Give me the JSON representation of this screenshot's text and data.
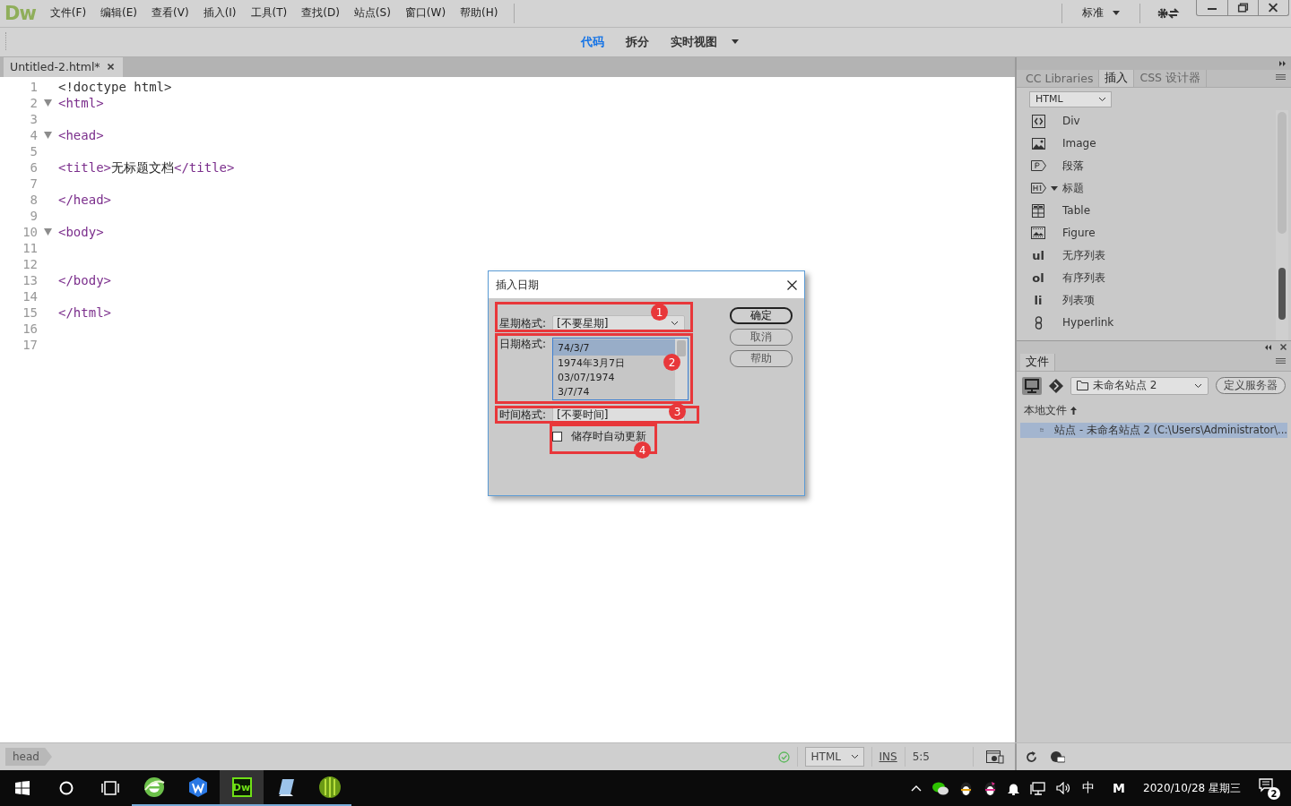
{
  "app": {
    "logo": "Dw",
    "menu": [
      "文件(F)",
      "编辑(E)",
      "查看(V)",
      "插入(I)",
      "工具(T)",
      "查找(D)",
      "站点(S)",
      "窗口(W)",
      "帮助(H)"
    ],
    "workspace": "标准"
  },
  "view_tabs": [
    {
      "label": "代码",
      "selected": true
    },
    {
      "label": "拆分",
      "selected": false
    },
    {
      "label": "实时视图",
      "selected": false
    }
  ],
  "document_tab": {
    "title": "Untitled-2.html*"
  },
  "code_lines": [
    {
      "number": "1",
      "foldable": false,
      "segments": [
        {
          "kind": "doctype",
          "text": "<!doctype html>"
        }
      ]
    },
    {
      "number": "2",
      "foldable": true,
      "segments": [
        {
          "kind": "tag",
          "text": "<html>"
        }
      ]
    },
    {
      "number": "3",
      "foldable": false
    },
    {
      "number": "4",
      "foldable": true,
      "segments": [
        {
          "kind": "tag",
          "text": "<head>"
        }
      ]
    },
    {
      "number": "5",
      "foldable": false
    },
    {
      "number": "6",
      "foldable": false,
      "segments": [
        {
          "kind": "tag",
          "text": "<title>"
        },
        {
          "kind": "text",
          "text": "无标题文档"
        },
        {
          "kind": "tag",
          "text": "</title>"
        }
      ]
    },
    {
      "number": "7",
      "foldable": false
    },
    {
      "number": "8",
      "foldable": false,
      "segments": [
        {
          "kind": "tag",
          "text": "</head>"
        }
      ]
    },
    {
      "number": "9",
      "foldable": false
    },
    {
      "number": "10",
      "foldable": true,
      "segments": [
        {
          "kind": "tag",
          "text": "<body>"
        }
      ]
    },
    {
      "number": "11",
      "foldable": false
    },
    {
      "number": "12",
      "foldable": false
    },
    {
      "number": "13",
      "foldable": false,
      "segments": [
        {
          "kind": "tag",
          "text": "</body>"
        }
      ]
    },
    {
      "number": "14",
      "foldable": false
    },
    {
      "number": "15",
      "foldable": false,
      "segments": [
        {
          "kind": "tag",
          "text": "</html>"
        }
      ]
    },
    {
      "number": "16",
      "foldable": false
    },
    {
      "number": "17",
      "foldable": false
    }
  ],
  "insert_panel": {
    "tabs": [
      {
        "label": "CC Libraries",
        "selected": false
      },
      {
        "label": "插入",
        "selected": true
      },
      {
        "label": "CSS 设计器",
        "selected": false
      }
    ],
    "category": "HTML",
    "items": [
      {
        "kind": "div",
        "label": "Div",
        "expandable": false
      },
      {
        "kind": "image",
        "label": "Image",
        "expandable": false
      },
      {
        "kind": "paragraph",
        "label": "段落",
        "expandable": false
      },
      {
        "kind": "heading",
        "label": "标题",
        "expandable": true
      },
      {
        "kind": "table",
        "label": "Table",
        "expandable": false
      },
      {
        "kind": "figure",
        "label": "Figure",
        "expandable": false
      },
      {
        "kind": "glyph",
        "glyph": "ul",
        "label": "无序列表",
        "expandable": false
      },
      {
        "kind": "glyph",
        "glyph": "ol",
        "label": "有序列表",
        "expandable": false
      },
      {
        "kind": "glyph",
        "glyph": "li",
        "label": "列表项",
        "expandable": false
      },
      {
        "kind": "hyperlink",
        "label": "Hyperlink",
        "expandable": false
      }
    ]
  },
  "files_panel": {
    "tab": "文件",
    "site": "未命名站点 2",
    "define_server": "定义服务器",
    "header": "本地文件",
    "rows": [
      {
        "label": "站点 - 未命名站点 2 (C:\\Users\\Administrator\\...",
        "selected": true
      }
    ]
  },
  "status_bar": {
    "tag": "head",
    "language": "HTML",
    "mode": "INS",
    "position": "5:5"
  },
  "dialog": {
    "title": "插入日期",
    "weekday_label": "星期格式:",
    "weekday_value": "[不要星期]",
    "date_label": "日期格式:",
    "date_options": [
      {
        "label": "74/3/7",
        "selected": true
      },
      {
        "label": "1974年3月7日",
        "selected": false
      },
      {
        "label": "03/07/1974",
        "selected": false
      },
      {
        "label": "3/7/74",
        "selected": false
      }
    ],
    "time_label": "时间格式:",
    "time_value": "[不要时间]",
    "auto_update": {
      "label": "储存时自动更新",
      "checked": false
    },
    "buttons": [
      {
        "label": "确定",
        "default": true
      },
      {
        "label": "取消",
        "default": false
      },
      {
        "label": "帮助",
        "default": false
      }
    ],
    "annotations": [
      "1",
      "2",
      "3",
      "4"
    ]
  },
  "taskbar": {
    "apps": [
      {
        "kind": "browser",
        "active": false
      },
      {
        "kind": "wps",
        "active": false
      },
      {
        "kind": "dreamweaver",
        "label": "Dw",
        "active": true
      },
      {
        "kind": "notepad",
        "active": false
      },
      {
        "kind": "ball",
        "active": false
      }
    ],
    "ime": "中",
    "ime_mode": "M",
    "date": "2020/10/28 星期三",
    "notifications": "2"
  }
}
